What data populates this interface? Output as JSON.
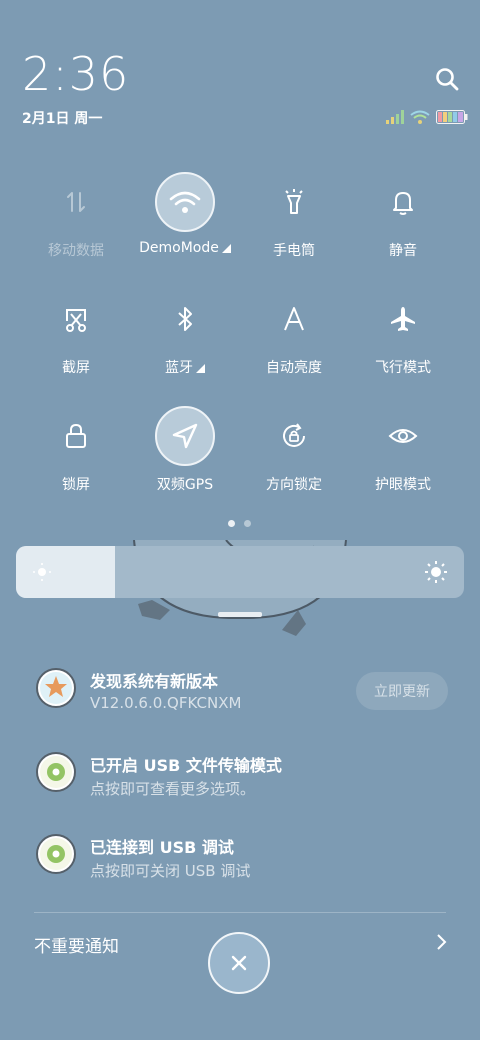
{
  "status": {
    "time": "2:36",
    "date": "2月1日 周一",
    "search_icon": "search-icon",
    "signal_icon": "signal-icon",
    "wifi_icon": "wifi-icon",
    "battery_icon": "battery-icon"
  },
  "quick_settings": {
    "tiles": [
      {
        "label": "移动数据",
        "icon": "mobile-data-icon",
        "state": "disabled"
      },
      {
        "label": "DemoMode",
        "icon": "wifi-icon",
        "state": "active"
      },
      {
        "label": "手电筒",
        "icon": "flashlight-icon",
        "state": "off"
      },
      {
        "label": "静音",
        "icon": "bell-icon",
        "state": "off"
      },
      {
        "label": "截屏",
        "icon": "screenshot-icon",
        "state": "off"
      },
      {
        "label": "蓝牙",
        "icon": "bluetooth-icon",
        "state": "off"
      },
      {
        "label": "自动亮度",
        "icon": "auto-brightness-icon",
        "state": "off"
      },
      {
        "label": "飞行模式",
        "icon": "airplane-icon",
        "state": "off"
      },
      {
        "label": "锁屏",
        "icon": "lock-icon",
        "state": "off"
      },
      {
        "label": "双频GPS",
        "icon": "gps-icon",
        "state": "active"
      },
      {
        "label": "方向锁定",
        "icon": "rotation-lock-icon",
        "state": "off"
      },
      {
        "label": "护眼模式",
        "icon": "eye-icon",
        "state": "off"
      }
    ],
    "page_indicator": {
      "pages": 2,
      "current": 1
    }
  },
  "brightness": {
    "level": 0.22
  },
  "notifications": [
    {
      "title": "发现系统有新版本",
      "subtitle": "V12.0.6.0.QFKCNXM",
      "action": "立即更新"
    },
    {
      "title": "已开启 USB 文件传输模式",
      "subtitle": "点按即可查看更多选项。"
    },
    {
      "title": "已连接到 USB 调试",
      "subtitle": "点按即可关闭 USB 调试"
    }
  ],
  "footer": {
    "unimportant_label": "不重要通知"
  }
}
